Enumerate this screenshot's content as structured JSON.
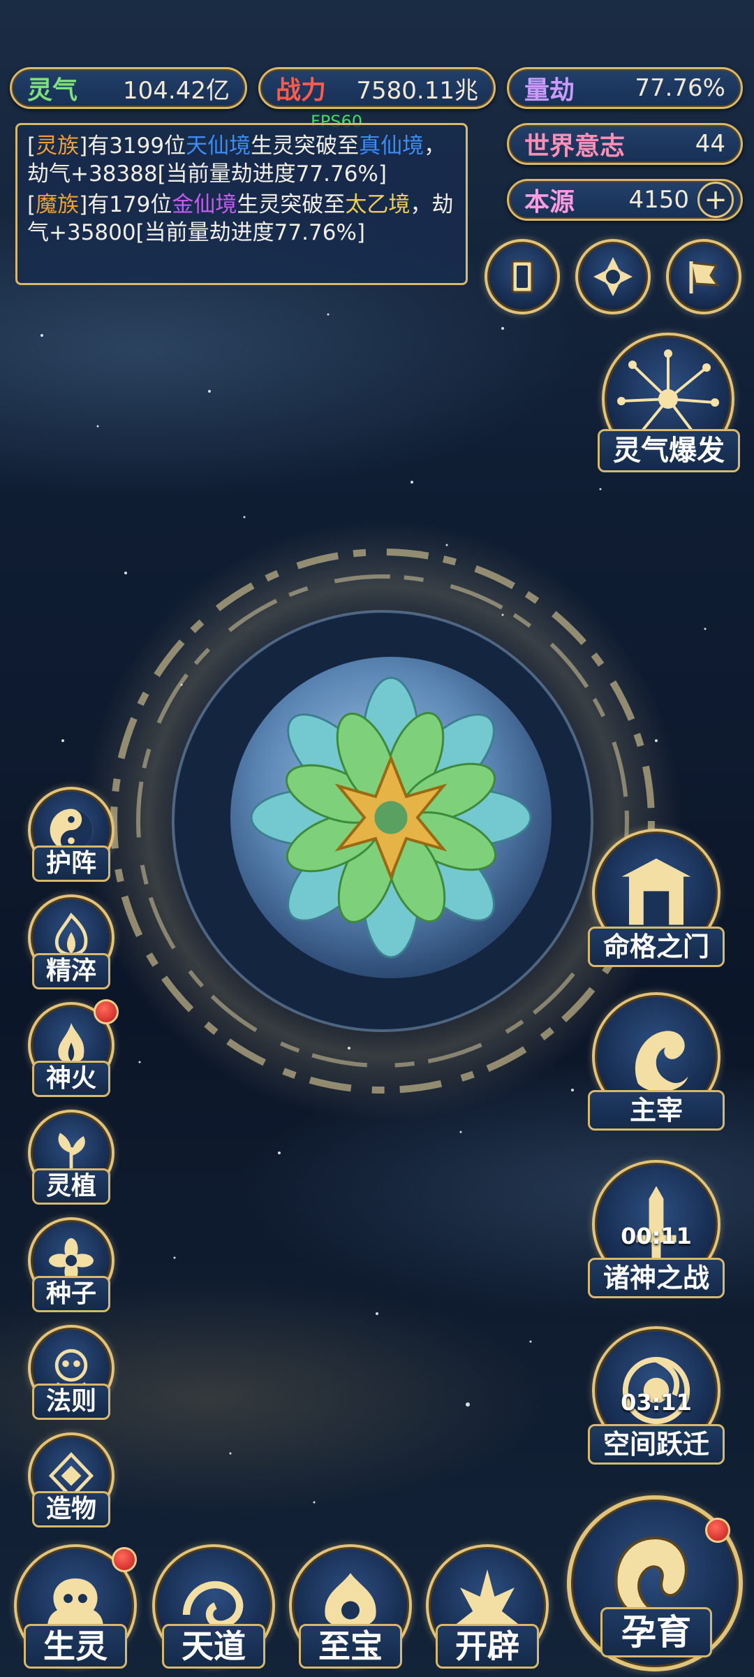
{
  "resources": {
    "lingqi": {
      "label": "灵气",
      "value": "104.42亿"
    },
    "zhanli": {
      "label": "战力",
      "value": "7580.11兆"
    },
    "liangjie": {
      "label": "量劫",
      "value": "77.76%"
    },
    "shijie": {
      "label": "世界意志",
      "value": "44"
    },
    "benyuan": {
      "label": "本源",
      "value": "4150"
    }
  },
  "fps": "FPS60",
  "log": [
    {
      "prefix": "[",
      "race": "灵族",
      "text1": "]有3199位",
      "realm1": "天仙境",
      "text2": "生灵突破至",
      "realm2": "真仙境",
      "text3": "，劫气+38388[当前量劫进度77.76%]"
    },
    {
      "prefix": "[",
      "race": "魔族",
      "text1": "]有179位",
      "realm1": "金仙境",
      "text2": "生灵突破至",
      "realm2": "太乙境",
      "text3": "，劫气+35800[当前量劫进度77.76%]"
    }
  ],
  "top_icons": [
    "card-icon",
    "vortex-icon",
    "flag-icon"
  ],
  "burst": {
    "label": "灵气爆发"
  },
  "left_menu": [
    {
      "label": "护阵",
      "icon": "yin-yang-icon",
      "badge": false
    },
    {
      "label": "精淬",
      "icon": "flame-shape-icon",
      "badge": false
    },
    {
      "label": "神火",
      "icon": "divine-fire-icon",
      "badge": true
    },
    {
      "label": "灵植",
      "icon": "spirit-plant-icon",
      "badge": false
    },
    {
      "label": "种子",
      "icon": "seed-icon",
      "badge": false
    },
    {
      "label": "法则",
      "icon": "law-icon",
      "badge": false
    },
    {
      "label": "造物",
      "icon": "creation-icon",
      "badge": false
    }
  ],
  "right_menu": [
    {
      "label": "命格之门",
      "icon": "gate-icon",
      "timer": ""
    },
    {
      "label": "主宰",
      "icon": "dragon-icon",
      "timer": ""
    },
    {
      "label": "诸神之战",
      "icon": "sword-icon",
      "timer": "00:11"
    },
    {
      "label": "空间跃迁",
      "icon": "portal-icon",
      "timer": "03:11"
    }
  ],
  "bottom_menu": [
    {
      "label": "生灵",
      "icon": "creature-icon",
      "badge": true
    },
    {
      "label": "天道",
      "icon": "heaven-icon",
      "badge": false
    },
    {
      "label": "至宝",
      "icon": "treasure-icon",
      "badge": false
    },
    {
      "label": "开辟",
      "icon": "open-icon",
      "badge": false
    }
  ],
  "breed": {
    "label": "孕育",
    "icon": "embryo-icon",
    "badge": true
  },
  "colors": {
    "gold": "#d8b86a",
    "blue_text": "#3b8df5",
    "purple_text": "#c45cf0",
    "orange_text": "#f0a030",
    "yellow_text": "#f0d050"
  }
}
